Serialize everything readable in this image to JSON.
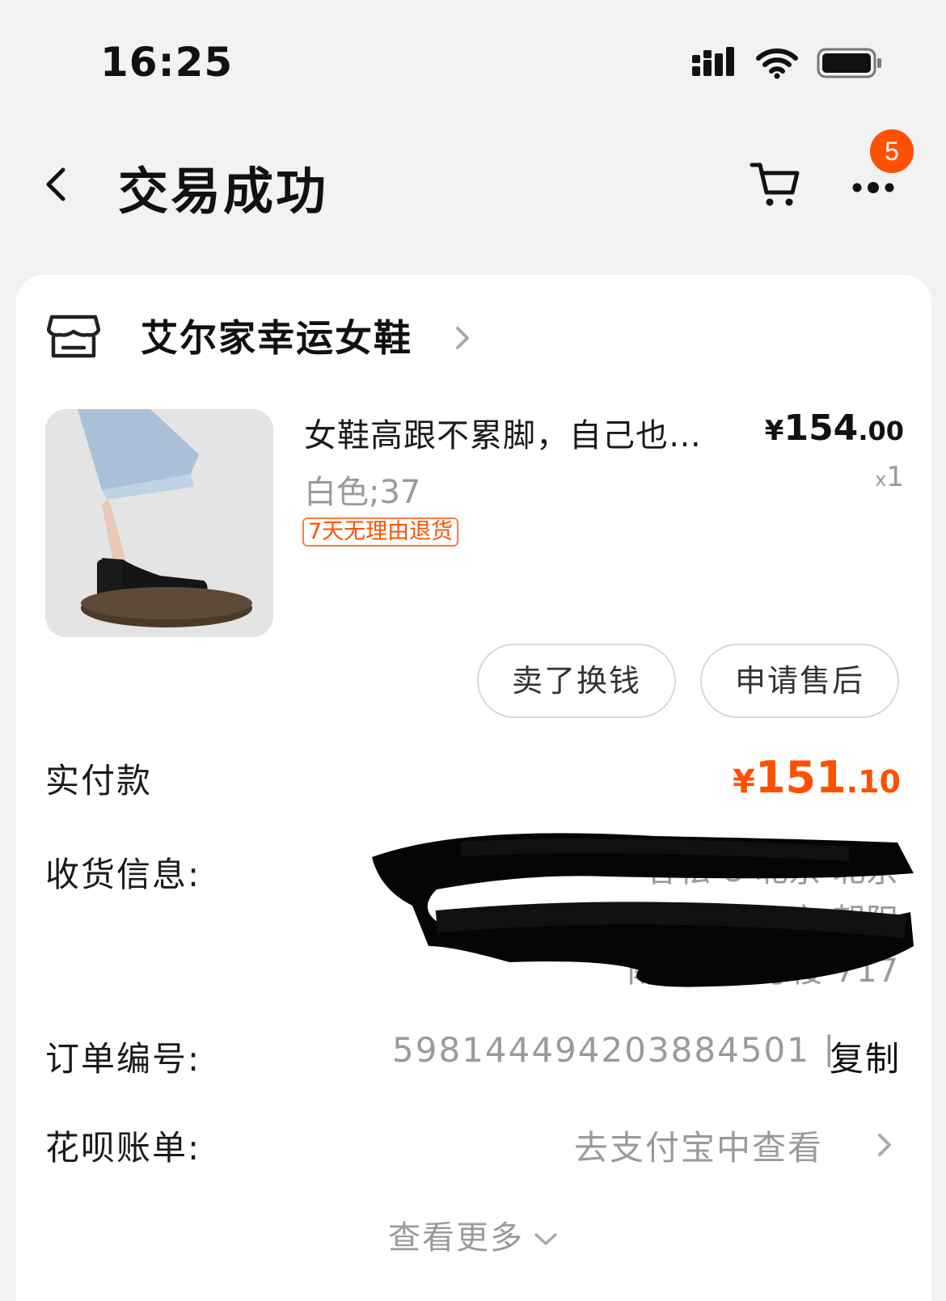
{
  "status_bar": {
    "time": "16:25"
  },
  "nav": {
    "title": "交易成功",
    "badge_count": "5"
  },
  "shop": {
    "name": "艾尔家幸运女鞋"
  },
  "product": {
    "title": "女鞋高跟不累脚，自己也…",
    "price_currency": "¥",
    "price_integer": "154",
    "price_decimal": ".00",
    "sku": "白色;37",
    "qty_prefix": "x",
    "qty": "1",
    "return_tag": "7天无理由退货"
  },
  "actions": {
    "sell_label": "卖了换钱",
    "after_sale_label": "申请售后"
  },
  "payment": {
    "label": "实付款",
    "currency": "¥",
    "integer": "151",
    "decimal": ".10"
  },
  "address": {
    "label": "收货信息:",
    "line1": "谷松 8 北京 北京",
    "line2": "市 朝阳",
    "line3": "南区 10 号楼 717"
  },
  "order": {
    "label": "订单编号:",
    "number": "5981444942038845​01",
    "separator": "|",
    "copy_label": "复制"
  },
  "huabei": {
    "label": "花呗账单:",
    "link": "去支付宝中查看"
  },
  "see_more": "查看更多",
  "colors": {
    "accent": "#ff5000",
    "muted": "#9a9a9a",
    "background": "#f2f2f2"
  }
}
